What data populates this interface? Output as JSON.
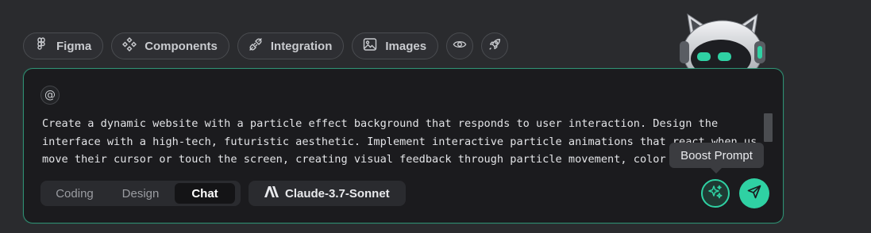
{
  "colors": {
    "accent": "#2fd1a3",
    "panel_border": "#2f8f72",
    "background": "#2a2b2e"
  },
  "chips": [
    {
      "label": "Figma",
      "icon": "figma-icon"
    },
    {
      "label": "Components",
      "icon": "components-icon"
    },
    {
      "label": "Integration",
      "icon": "plug-icon"
    },
    {
      "label": "Images",
      "icon": "image-icon"
    }
  ],
  "icon_buttons": [
    {
      "icon": "eye-icon"
    },
    {
      "icon": "rocket-icon"
    }
  ],
  "mascot": {
    "icon": "robot-cat-mascot"
  },
  "composer": {
    "mention_label": "@",
    "prompt_lines": [
      "Create a dynamic website with a particle effect background that responds to user interaction. Design the",
      "interface with a high-tech, futuristic aesthetic. Implement interactive particle animations that react when users",
      "move their cursor or touch the screen, creating visual feedback through particle movement, color changes"
    ],
    "modes": [
      {
        "label": "Coding",
        "active": false
      },
      {
        "label": "Design",
        "active": false
      },
      {
        "label": "Chat",
        "active": true
      }
    ],
    "model": {
      "label": "Claude-3.7-Sonnet",
      "icon": "anthropic-logo-icon"
    },
    "boost_tooltip": "Boost Prompt",
    "boost_icon": "sparkles-icon",
    "send_icon": "send-icon"
  }
}
